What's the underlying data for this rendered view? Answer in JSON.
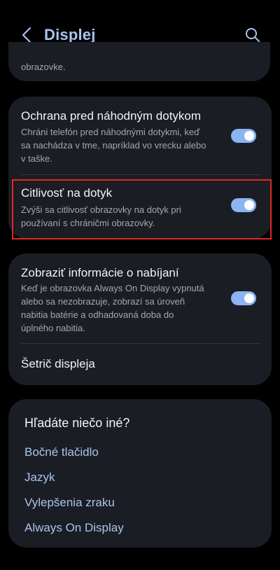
{
  "header": {
    "title": "Displej",
    "back_icon": "back-chevron-icon",
    "search_icon": "search-icon"
  },
  "top_card": {
    "fragment": "obrazovke."
  },
  "settings": {
    "accidental_touch": {
      "title": "Ochrana pred náhodným dotykom",
      "desc_1": "Chráni telefón pred náhodnými dotykmi, keď",
      "desc_2": "sa nachádza v tme, napríklad vo vrecku alebo",
      "desc_3": "v taške.",
      "enabled": true
    },
    "touch_sensitivity": {
      "title": "Citlivosť na dotyk",
      "desc_1": "Zvýši sa citlivosť obrazovky na dotyk pri",
      "desc_2": "používaní s chráničmi obrazovky.",
      "enabled": true
    },
    "charging_info": {
      "title": "Zobraziť informácie o nabíjaní",
      "desc_1": "Keď je obrazovka Always On Display vypnutá",
      "desc_2": "alebo sa nezobrazuje, zobrazí sa úroveň",
      "desc_3": "nabitia batérie a odhadovaná doba do",
      "desc_4": "úplného nabitia.",
      "enabled": true
    },
    "screen_saver": {
      "title": "Šetrič displeja"
    }
  },
  "suggestions": {
    "title": "Hľadáte niečo iné?",
    "links": [
      "Bočné tlačidlo",
      "Jazyk",
      "Vylepšenia zraku",
      "Always On Display"
    ]
  },
  "colors": {
    "background": "#000000",
    "card": "#1b1d24",
    "accent": "#a9c4ee",
    "toggle_on": "#8ab4f2",
    "highlight": "#e02828"
  }
}
